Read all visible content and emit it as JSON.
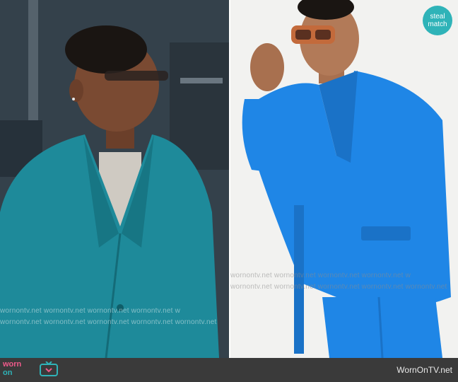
{
  "watermark": {
    "row_top": "wornontv.net  wornontv.net  wornontv.net  wornontv.net  w",
    "row_bottom": "wornontv.net  wornontv.net  wornontv.net  wornontv.net  wornontv.net"
  },
  "badge": {
    "line1": "steal",
    "line2": "match"
  },
  "footer": {
    "logo_line1": "worn",
    "logo_line2": "on",
    "site": "WornOnTV.net"
  },
  "colors": {
    "left_jacket": "#1e8a9a",
    "right_suit": "#1f86e6",
    "badge": "#2fb3b8",
    "logo_pink": "#f05a8b",
    "logo_teal": "#2fb3b8",
    "footer_bg": "#3a3a3a"
  }
}
